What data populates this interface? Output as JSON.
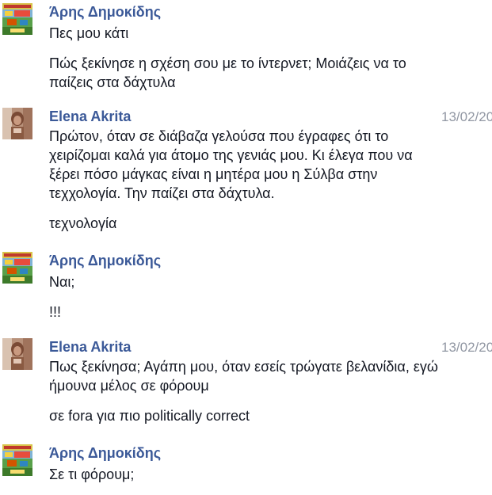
{
  "thread": {
    "groups": [
      {
        "sender": "Άρης Δημοκίδης",
        "timestamp": "",
        "paragraphs": [
          [
            "Πες μου κάτι"
          ],
          [
            "Πώς ξεκίνησε η σχέση σου με το ίντερνετ; Μοιάζεις να το",
            "παίζεις στα δάχτυλα"
          ]
        ]
      },
      {
        "sender": "Elena Akrita",
        "timestamp": "13/02/20",
        "paragraphs": [
          [
            "Πρώτον, όταν σε διάβαζα γελούσα που έγραφες ότι το",
            "χειρίζομαι καλά για άτομο της γενιάς μου. Κι έλεγα που να",
            "ξέρει πόσο μάγκας είναι η μητέρα μου η Σύλβα στην",
            "τεχχολογία. Την παίζει στα δάχτυλα."
          ],
          [
            "τεχνολογία"
          ]
        ]
      },
      {
        "sender": "Άρης Δημοκίδης",
        "timestamp": "",
        "paragraphs": [
          [
            "Ναι;"
          ],
          [
            "!!!"
          ]
        ]
      },
      {
        "sender": "Elena Akrita",
        "timestamp": "13/02/20",
        "paragraphs": [
          [
            "Πως ξεκίνησα; Αγάπη μου, όταν εσείς τρώγατε βελανίδια, εγώ",
            "ήμουνα μέλος σε φόρουμ"
          ],
          [
            "σε fora για πιο politically correct"
          ]
        ]
      },
      {
        "sender": "Άρης Δημοκίδης",
        "timestamp": "",
        "paragraphs": [
          [
            "Σε τι φόρουμ;"
          ]
        ]
      }
    ]
  },
  "colors": {
    "sender_name": "#3b5998",
    "message_text": "#141823",
    "timestamp": "#9197a3",
    "background": "#ffffff"
  },
  "icons": {
    "aris_avatar": "avatar-aris-icon",
    "elena_avatar": "avatar-elena-icon"
  }
}
